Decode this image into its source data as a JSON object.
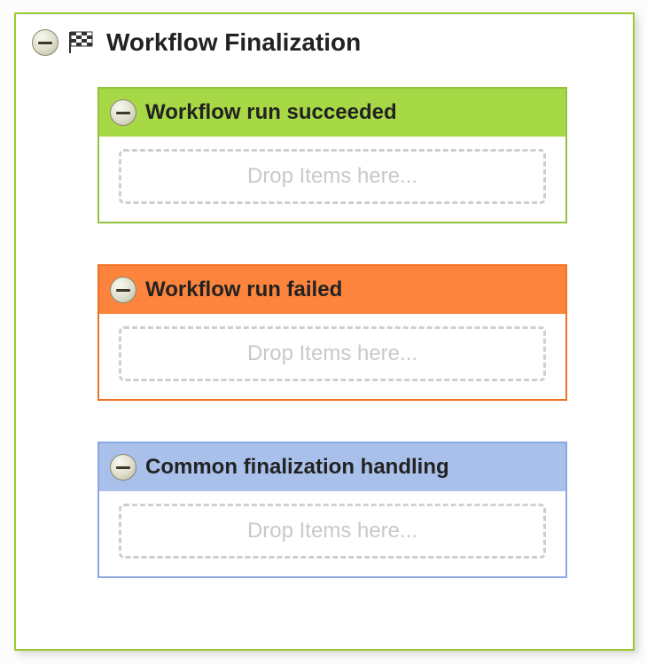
{
  "panel": {
    "title": "Workflow Finalization"
  },
  "sections": {
    "succeeded": {
      "title": "Workflow run succeeded",
      "drop_text": "Drop Items here..."
    },
    "failed": {
      "title": "Workflow run failed",
      "drop_text": "Drop Items here..."
    },
    "common": {
      "title": "Common finalization handling",
      "drop_text": "Drop Items here..."
    }
  },
  "colors": {
    "outer_border": "#9acb34",
    "succeeded_bg": "#a7d845",
    "failed_bg": "#fc843c",
    "common_bg": "#a8c0ea"
  }
}
